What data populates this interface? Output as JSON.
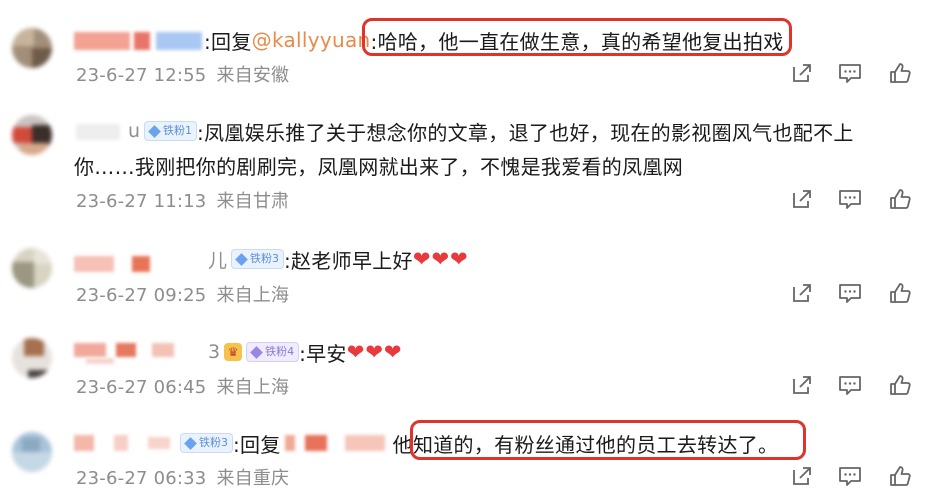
{
  "comments": [
    {
      "reply_prefix": ":回复",
      "mention": "@kallyyuan",
      "text": ":哈哈，他一直在做生意，真的希望他复出拍戏",
      "date": "23-6-27 12:55",
      "location": "来自安徽"
    },
    {
      "name_fragment": "u",
      "badge": "铁粉1",
      "text_line1": ":凤凰娱乐推了关于想念你的文章，退了也好，现在的影视圈风气也配不上",
      "text_line2": "你……我刚把你的剧刷完，凤凰网就出来了，不愧是我爱看的凤凰网",
      "date": "23-6-27 11:13",
      "location": "来自甘肃"
    },
    {
      "name_fragment": "儿",
      "badge": "铁粉3",
      "text": ":赵老师早上好",
      "hearts": "❤❤❤",
      "date": "23-6-27 09:25",
      "location": "来自上海"
    },
    {
      "name_fragment": "3",
      "badge": "铁粉4",
      "text": ":早安",
      "hearts": "❤❤❤",
      "date": "23-6-27 06:45",
      "location": "来自上海"
    },
    {
      "badge": "铁粉3",
      "reply_prefix": ":回复",
      "text": "他知道的，有粉丝通过他的员工去转达了。",
      "date": "23-6-27 06:33",
      "location": "来自重庆"
    }
  ],
  "icons": {
    "share": "share-icon",
    "comment": "comment-icon",
    "like": "thumbs-up-icon",
    "fan_badge": "diamond-icon",
    "crown": "crown-icon"
  },
  "colors": {
    "highlight": "#e0332c",
    "mention": "#ea8a4a",
    "meta": "#8d8d8d",
    "heart": "#e8393c",
    "badge": "#5b8fd6"
  }
}
